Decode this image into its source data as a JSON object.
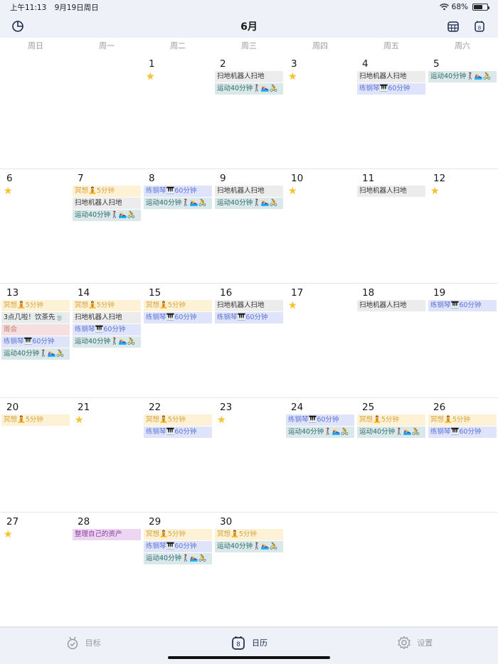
{
  "status": {
    "time": "上午11:13",
    "date": "9月19日周日",
    "battery": "68%",
    "battery_level": 0.68
  },
  "nav": {
    "title": "6月",
    "calendar_icon_label": "8"
  },
  "weekdays": [
    "周日",
    "周一",
    "周二",
    "周三",
    "周四",
    "周五",
    "周六"
  ],
  "weeks": [
    [
      {
        "day": "",
        "star": false,
        "events": []
      },
      {
        "day": "",
        "star": false,
        "events": []
      },
      {
        "day": "1",
        "star": true,
        "events": []
      },
      {
        "day": "2",
        "star": false,
        "events": [
          {
            "text": "扫地机器人扫地",
            "color": "gray"
          },
          {
            "text": "运动40分钟🚶‍♀️🏊‍♀️🚴",
            "color": "teal"
          }
        ]
      },
      {
        "day": "3",
        "star": true,
        "events": []
      },
      {
        "day": "4",
        "star": false,
        "events": [
          {
            "text": "扫地机器人扫地",
            "color": "gray"
          },
          {
            "text": "练钢琴🎹60分钟",
            "color": "blue"
          }
        ]
      },
      {
        "day": "5",
        "star": false,
        "events": [
          {
            "text": "运动40分钟🚶‍♀️🏊‍♀️🚴",
            "color": "teal"
          }
        ]
      }
    ],
    [
      {
        "day": "6",
        "star": true,
        "events": []
      },
      {
        "day": "7",
        "star": false,
        "events": [
          {
            "text": "冥想🧘5分钟",
            "color": "yellow"
          },
          {
            "text": "扫地机器人扫地",
            "color": "gray"
          },
          {
            "text": "运动40分钟🚶‍♀️🏊‍♀️🚴",
            "color": "teal"
          }
        ]
      },
      {
        "day": "8",
        "star": false,
        "events": [
          {
            "text": "练钢琴🎹60分钟",
            "color": "blue"
          },
          {
            "text": "运动40分钟🚶‍♀️🏊‍♀️🚴",
            "color": "teal"
          }
        ]
      },
      {
        "day": "9",
        "star": false,
        "events": [
          {
            "text": "扫地机器人扫地",
            "color": "gray"
          },
          {
            "text": "运动40分钟🚶‍♀️🏊‍♀️🚴",
            "color": "teal"
          }
        ]
      },
      {
        "day": "10",
        "star": true,
        "events": []
      },
      {
        "day": "11",
        "star": false,
        "events": [
          {
            "text": "扫地机器人扫地",
            "color": "gray"
          }
        ]
      },
      {
        "day": "12",
        "star": true,
        "events": []
      }
    ],
    [
      {
        "day": "13",
        "star": false,
        "events": [
          {
            "text": "冥想🧘5分钟",
            "color": "yellow"
          },
          {
            "text": "3点几啦！饮茶先🍵",
            "color": "gray2"
          },
          {
            "text": "周会",
            "color": "pink"
          },
          {
            "text": "练钢琴🎹60分钟",
            "color": "blue"
          },
          {
            "text": "运动40分钟🚶‍♀️🏊‍♀️🚴",
            "color": "teal"
          }
        ]
      },
      {
        "day": "14",
        "star": false,
        "events": [
          {
            "text": "冥想🧘5分钟",
            "color": "yellow"
          },
          {
            "text": "扫地机器人扫地",
            "color": "gray"
          },
          {
            "text": "练钢琴🎹60分钟",
            "color": "blue"
          },
          {
            "text": "运动40分钟🚶‍♀️🏊‍♀️🚴",
            "color": "teal"
          }
        ]
      },
      {
        "day": "15",
        "star": false,
        "events": [
          {
            "text": "冥想🧘5分钟",
            "color": "yellow"
          },
          {
            "text": "练钢琴🎹60分钟",
            "color": "blue"
          }
        ]
      },
      {
        "day": "16",
        "star": false,
        "events": [
          {
            "text": "扫地机器人扫地",
            "color": "gray"
          },
          {
            "text": "练钢琴🎹60分钟",
            "color": "blue"
          }
        ]
      },
      {
        "day": "17",
        "star": true,
        "events": []
      },
      {
        "day": "18",
        "star": false,
        "events": [
          {
            "text": "扫地机器人扫地",
            "color": "gray"
          }
        ]
      },
      {
        "day": "19",
        "star": false,
        "events": [
          {
            "text": "练钢琴🎹60分钟",
            "color": "blue"
          }
        ]
      }
    ],
    [
      {
        "day": "20",
        "star": false,
        "events": [
          {
            "text": "冥想🧘5分钟",
            "color": "yellow"
          }
        ]
      },
      {
        "day": "21",
        "star": true,
        "events": []
      },
      {
        "day": "22",
        "star": false,
        "events": [
          {
            "text": "冥想🧘5分钟",
            "color": "yellow"
          },
          {
            "text": "练钢琴🎹60分钟",
            "color": "blue"
          }
        ]
      },
      {
        "day": "23",
        "star": true,
        "events": []
      },
      {
        "day": "24",
        "star": false,
        "events": [
          {
            "text": "练钢琴🎹60分钟",
            "color": "blue"
          },
          {
            "text": "运动40分钟🚶‍♀️🏊‍♀️🚴",
            "color": "teal"
          }
        ]
      },
      {
        "day": "25",
        "star": false,
        "events": [
          {
            "text": "冥想🧘5分钟",
            "color": "yellow"
          },
          {
            "text": "运动40分钟🚶‍♀️🏊‍♀️🚴",
            "color": "teal"
          }
        ]
      },
      {
        "day": "26",
        "star": false,
        "events": [
          {
            "text": "冥想🧘5分钟",
            "color": "yellow"
          },
          {
            "text": "练钢琴🎹60分钟",
            "color": "blue"
          }
        ]
      }
    ],
    [
      {
        "day": "27",
        "star": true,
        "events": []
      },
      {
        "day": "28",
        "star": false,
        "events": [
          {
            "text": "整理自己的资产",
            "color": "purple"
          }
        ]
      },
      {
        "day": "29",
        "star": false,
        "events": [
          {
            "text": "冥想🧘5分钟",
            "color": "yellow"
          },
          {
            "text": "练钢琴🎹60分钟",
            "color": "blue"
          },
          {
            "text": "运动40分钟🚶‍♀️🏊‍♀️🚴",
            "color": "teal"
          }
        ]
      },
      {
        "day": "30",
        "star": false,
        "events": [
          {
            "text": "冥想🧘5分钟",
            "color": "yellow"
          },
          {
            "text": "运动40分钟🚶‍♀️🏊‍♀️🚴",
            "color": "teal"
          }
        ]
      },
      {
        "day": "",
        "star": false,
        "events": []
      },
      {
        "day": "",
        "star": false,
        "events": []
      },
      {
        "day": "",
        "star": false,
        "events": []
      }
    ]
  ],
  "tabs": [
    {
      "label": "目标",
      "icon": "goal-medal-icon",
      "active": false
    },
    {
      "label": "日历",
      "icon": "calendar-icon",
      "icon_text": "8",
      "active": true
    },
    {
      "label": "设置",
      "icon": "gear-icon",
      "active": false
    }
  ],
  "colors": {
    "header_bg": "#eef1f8",
    "star": "#f4c531",
    "active_tab": "#1e2a4a",
    "inactive_tab": "#9a9a9a"
  }
}
